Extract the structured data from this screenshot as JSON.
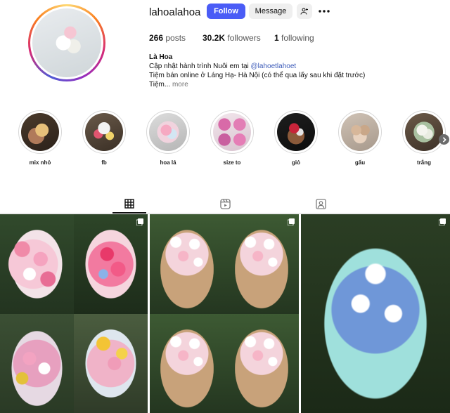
{
  "profile": {
    "username": "lahoalahoa",
    "follow_label": "Follow",
    "message_label": "Message",
    "posts_count": "266",
    "posts_label": "posts",
    "followers_count": "30.2K",
    "followers_label": "followers",
    "following_count": "1",
    "following_label": "following",
    "display_name": "Là Hoa",
    "bio_line1_prefix": "Cập nhật hành trình Nuôi em tại ",
    "bio_line1_link": "@lahoetlahoet",
    "bio_line2": "Tiệm bán online ở Láng Hạ- Hà Nội (có thể qua lấy sau khi đặt trước)",
    "bio_line3": "Tiệm...",
    "bio_more": "more"
  },
  "highlights": [
    {
      "label": "mix nhỏ"
    },
    {
      "label": "fb"
    },
    {
      "label": "hoa lá"
    },
    {
      "label": "size to"
    },
    {
      "label": "giỏ"
    },
    {
      "label": "gấu"
    },
    {
      "label": "trắng"
    }
  ],
  "tabs": [
    {
      "name": "posts",
      "icon": "grid-icon",
      "active": true
    },
    {
      "name": "reels",
      "icon": "reels-icon",
      "active": false
    },
    {
      "name": "tagged",
      "icon": "tagged-icon",
      "active": false
    }
  ],
  "colors": {
    "follow_button": "#4a5cf6",
    "secondary_button": "#efefef",
    "link": "#3b5ab8"
  }
}
